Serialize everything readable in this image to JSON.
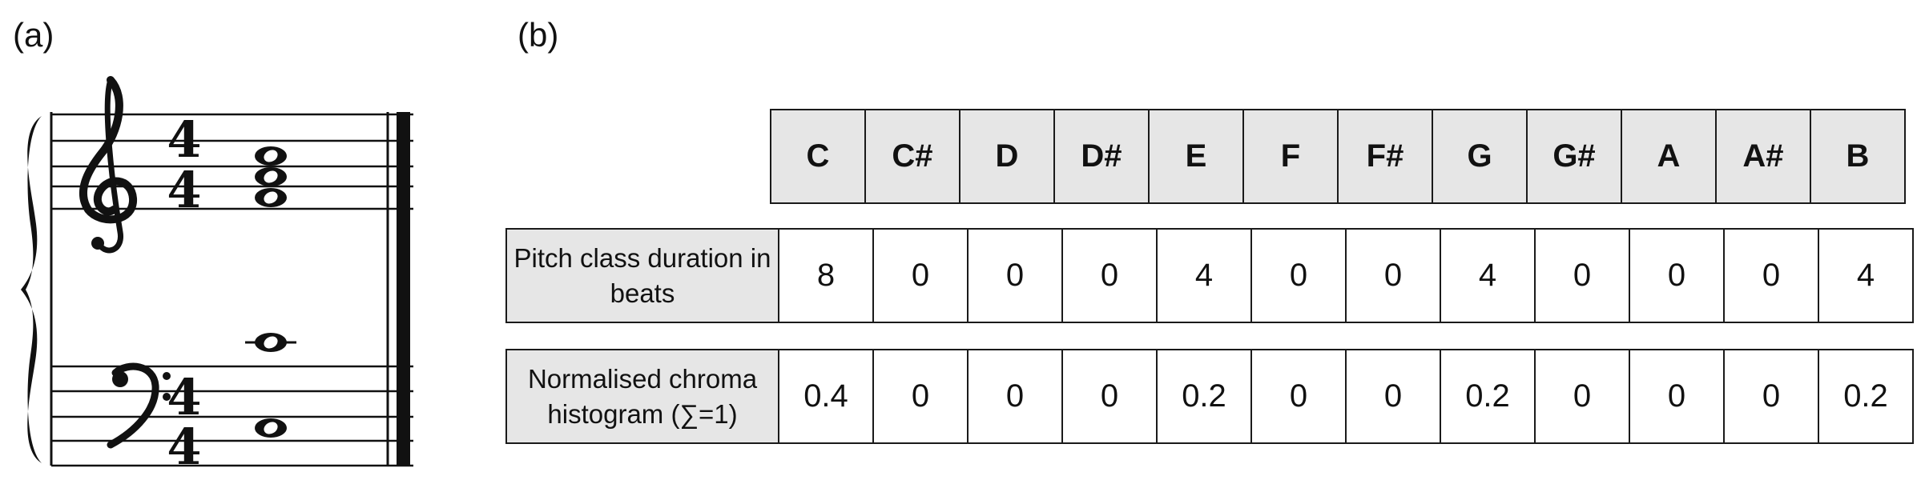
{
  "panels": {
    "a": "(a)",
    "b": "(b)"
  },
  "score": {
    "treble_time_signature": {
      "top": "4",
      "bottom": "4"
    },
    "bass_time_signature": {
      "top": "4",
      "bottom": "4"
    },
    "treble_chord_notes": [
      "E4",
      "G4",
      "B4"
    ],
    "bass_notes": [
      "C3",
      "C4"
    ]
  },
  "table": {
    "pitch_classes": [
      "C",
      "C#",
      "D",
      "D#",
      "E",
      "F",
      "F#",
      "G",
      "G#",
      "A",
      "A#",
      "B"
    ],
    "rows": [
      {
        "label": "Pitch class duration in beats",
        "values": [
          "8",
          "0",
          "0",
          "0",
          "4",
          "0",
          "0",
          "4",
          "0",
          "0",
          "0",
          "4"
        ]
      },
      {
        "label": "Normalised chroma histogram (∑=1)",
        "values": [
          "0.4",
          "0",
          "0",
          "0",
          "0.2",
          "0",
          "0",
          "0.2",
          "0",
          "0",
          "0",
          "0.2"
        ]
      }
    ]
  }
}
